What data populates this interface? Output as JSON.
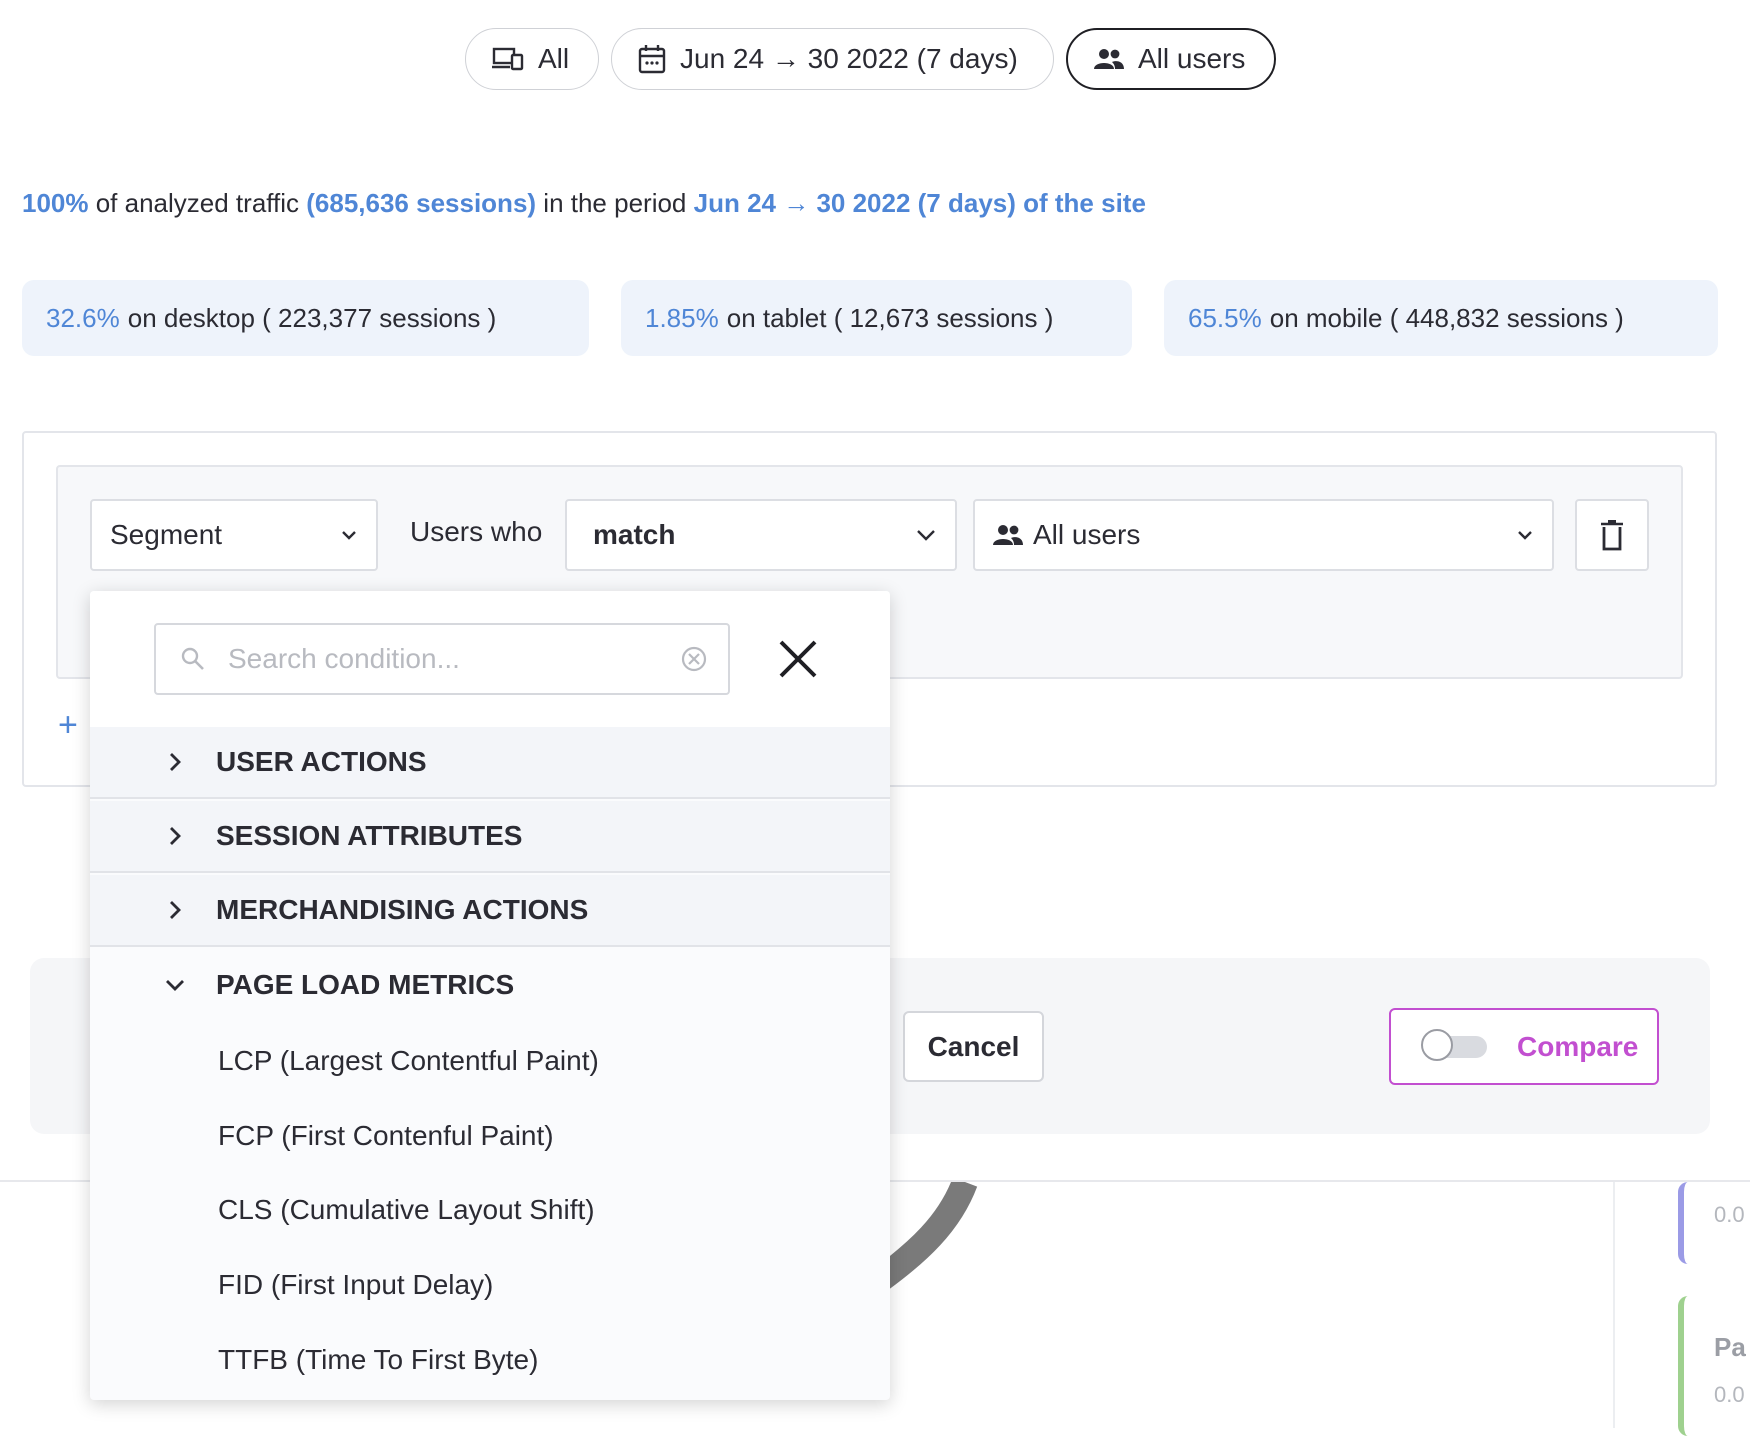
{
  "filters": {
    "device": "All",
    "date_range": "Jun 24 → 30 2022 (7 days)",
    "segment": "All users"
  },
  "summary": {
    "percent": "100%",
    "text1": " of analyzed traffic ",
    "sessions": "(685,636 sessions)",
    "text2": " in the period ",
    "period": "Jun 24 → 30 2022 (7 days) of the site"
  },
  "devices": [
    {
      "pct": "32.6%",
      "label": "on desktop ( 223,377 sessions )"
    },
    {
      "pct": "1.85%",
      "label": "on tablet ( 12,673 sessions )"
    },
    {
      "pct": "65.5%",
      "label": "on mobile ( 448,832 sessions )"
    }
  ],
  "segment_row": {
    "type_select": "Segment",
    "users_who": "Users who",
    "match_select": "match",
    "users_select": "All users"
  },
  "dropdown": {
    "search_placeholder": "Search condition...",
    "categories": [
      {
        "label": "USER ACTIONS",
        "expanded": false
      },
      {
        "label": "SESSION ATTRIBUTES",
        "expanded": false
      },
      {
        "label": "MERCHANDISING ACTIONS",
        "expanded": false
      },
      {
        "label": "PAGE LOAD METRICS",
        "expanded": true
      }
    ],
    "options": [
      "LCP (Largest Contentful Paint)",
      "FCP (First Contenful Paint)",
      "CLS (Cumulative Layout Shift)",
      "FID (First Input Delay)",
      "TTFB (Time To First Byte)"
    ]
  },
  "actions": {
    "cancel": "Cancel",
    "compare": "Compare",
    "compare_enabled": false
  },
  "background": {
    "card1_value": "0.0",
    "card2_title": "Pa",
    "card2_value": "0.0"
  },
  "colors": {
    "accent_blue": "#4f86d6",
    "compare_magenta": "#c24fd0",
    "chip_bg": "#eef3fb"
  }
}
